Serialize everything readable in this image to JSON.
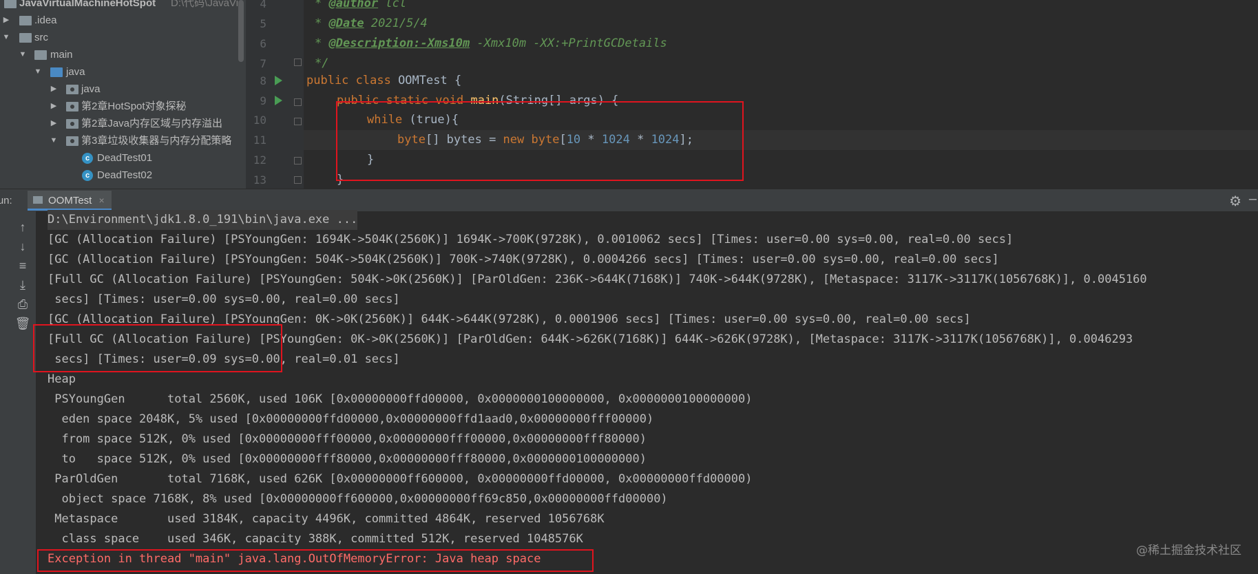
{
  "project_tree": {
    "items": [
      {
        "arrow": "",
        "icon": "module",
        "label": "JavaVirtualMachineHotSpot",
        "path": "D:\\代码\\JavaVir",
        "depth": 0
      },
      {
        "arrow": "▶",
        "icon": "folder",
        "label": ".idea",
        "depth": 0
      },
      {
        "arrow": "▼",
        "icon": "folder",
        "label": "src",
        "depth": 0
      },
      {
        "arrow": "▼",
        "icon": "folder",
        "label": "main",
        "depth": 1
      },
      {
        "arrow": "▼",
        "icon": "folder-blue",
        "label": "java",
        "depth": 2
      },
      {
        "arrow": "▶",
        "icon": "package",
        "label": "java",
        "depth": 3
      },
      {
        "arrow": "▶",
        "icon": "package",
        "label": "第2章HotSpot对象探秘",
        "depth": 3
      },
      {
        "arrow": "▶",
        "icon": "package",
        "label": "第2章Java内存区域与内存溢出",
        "depth": 3
      },
      {
        "arrow": "▼",
        "icon": "package",
        "label": "第3章垃圾收集器与内存分配策略",
        "depth": 3
      },
      {
        "arrow": "",
        "icon": "class",
        "label": "DeadTest01",
        "depth": 4
      },
      {
        "arrow": "",
        "icon": "class",
        "label": "DeadTest02",
        "depth": 4
      }
    ]
  },
  "editor": {
    "line_numbers": [
      "4",
      "5",
      "6",
      "7",
      "8",
      "9",
      "10",
      "11",
      "12",
      "13"
    ],
    "lines": {
      "l4": [
        "@author",
        " lcl"
      ],
      "l5": [
        "@Date",
        " 2021/5/4"
      ],
      "l6": [
        "@Description:-Xms10m",
        " -Xmx10m -XX:+PrintGCDetails"
      ],
      "l7": "*/",
      "l8": {
        "kw": "public class ",
        "name": "OOMTest",
        "rest": " {"
      },
      "l9": {
        "kw": "public static void ",
        "fn": "main",
        "rest": "(String[] args) {"
      },
      "l10": {
        "kw": "while ",
        "rest": "(true){"
      },
      "l11": {
        "kw1": "byte",
        "a": "[] bytes = ",
        "kw2": "new byte",
        "b": "[",
        "n1": "10",
        "c": " * ",
        "n2": "1024",
        "d": " * ",
        "n3": "1024",
        "e": "];"
      },
      "l12": "}",
      "l13": "}"
    },
    "doc_prefix": "* ",
    "current_line": "11"
  },
  "run_panel": {
    "label": "Run:",
    "tab": "OOMTest",
    "tab_close": "×"
  },
  "console": {
    "lines": [
      "D:\\Environment\\jdk1.8.0_191\\bin\\java.exe ...",
      "[GC (Allocation Failure) [PSYoungGen: 1694K->504K(2560K)] 1694K->700K(9728K), 0.0010062 secs] [Times: user=0.00 sys=0.00, real=0.00 secs]",
      "[GC (Allocation Failure) [PSYoungGen: 504K->504K(2560K)] 700K->740K(9728K), 0.0004266 secs] [Times: user=0.00 sys=0.00, real=0.00 secs]",
      "[Full GC (Allocation Failure) [PSYoungGen: 504K->0K(2560K)] [ParOldGen: 236K->644K(7168K)] 740K->644K(9728K), [Metaspace: 3117K->3117K(1056768K)], 0.0045160",
      " secs] [Times: user=0.00 sys=0.00, real=0.00 secs]",
      "[GC (Allocation Failure) [PSYoungGen: 0K->0K(2560K)] 644K->644K(9728K), 0.0001906 secs] [Times: user=0.00 sys=0.00, real=0.00 secs]",
      "[Full GC (Allocation Failure) [PSYoungGen: 0K->0K(2560K)] [ParOldGen: 644K->626K(7168K)] 644K->626K(9728K), [Metaspace: 3117K->3117K(1056768K)], 0.0046293",
      " secs] [Times: user=0.09 sys=0.00, real=0.01 secs]",
      "Heap",
      " PSYoungGen      total 2560K, used 106K [0x00000000ffd00000, 0x0000000100000000, 0x0000000100000000)",
      "  eden space 2048K, 5% used [0x00000000ffd00000,0x00000000ffd1aad0,0x00000000fff00000)",
      "  from space 512K, 0% used [0x00000000fff00000,0x00000000fff00000,0x00000000fff80000)",
      "  to   space 512K, 0% used [0x00000000fff80000,0x00000000fff80000,0x0000000100000000)",
      " ParOldGen       total 7168K, used 626K [0x00000000ff600000, 0x00000000ffd00000, 0x00000000ffd00000)",
      "  object space 7168K, 8% used [0x00000000ff600000,0x00000000ff69c850,0x00000000ffd00000)",
      " Metaspace       used 3184K, capacity 4496K, committed 4864K, reserved 1056768K",
      "  class space    used 346K, capacity 388K, committed 512K, reserved 1048576K"
    ],
    "error": "Exception in thread \"main\" java.lang.OutOfMemoryError: Java heap space"
  },
  "watermark": "@稀土掘金技术社区",
  "colors": {
    "highlight_box": "#e0141e",
    "error_text": "#ff6b68",
    "keyword": "#cc7832"
  }
}
